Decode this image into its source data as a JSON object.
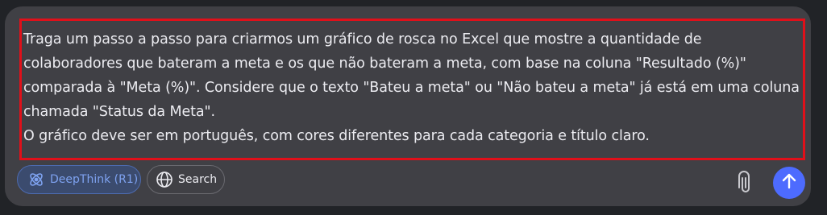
{
  "prompt": {
    "lines": [
      "Traga um passo a passo para criarmos um gráfico de rosca no Excel que mostre a quantidade de",
      "colaboradores que bateram a meta e os que não bateram a meta, com base na coluna \"Resultado (%)\"",
      "comparada à \"Meta (%)\". Considere que o texto \"Bateu a meta\" ou \"Não bateu a meta\" já está em uma coluna",
      "chamada \"Status da Meta\".",
      "O gráfico deve ser em português, com cores diferentes para cada categoria e título claro."
    ]
  },
  "toolbar": {
    "deepthink_label": "DeepThink (R1)",
    "deepthink_icon": "atom-icon",
    "search_label": "Search",
    "search_icon": "globe-icon",
    "attach_icon": "paperclip-icon",
    "send_icon": "arrow-up-icon"
  },
  "colors": {
    "send_button": "#4d6bfe",
    "deepthink_text": "#7ea2f0",
    "highlight_border": "#e0101a"
  }
}
